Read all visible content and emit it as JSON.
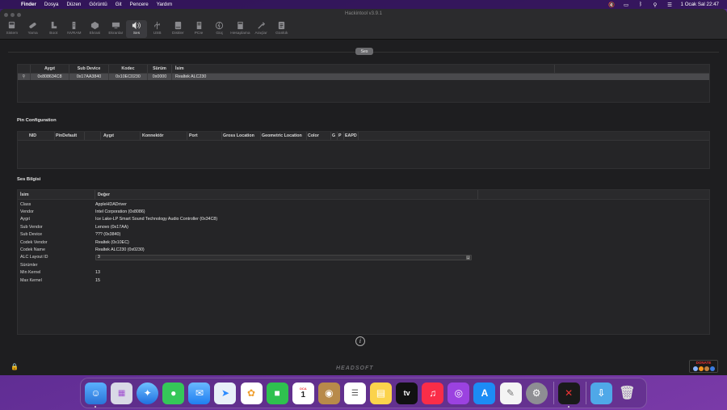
{
  "menubar": {
    "items": [
      "Finder",
      "Dosya",
      "Düzen",
      "Görüntü",
      "Git",
      "Pencere",
      "Yardım"
    ],
    "clock": "1 Ocak Sal  22:47"
  },
  "window": {
    "title": "Hackintool v3.9.1",
    "toolbar": [
      "Sistem",
      "Yama",
      "Boot",
      "NVRAM",
      "Ekrani",
      "Ekranlar",
      "Ses",
      "USB",
      "Diskler",
      "PCIe",
      "Güç",
      "Hesaplama",
      "Araçlar",
      "Günlük"
    ],
    "active_tab": "Ses"
  },
  "audio_devices": {
    "headers": [
      "Aygıt",
      "Sub Device",
      "Kodec",
      "Sürüm",
      "İsim"
    ],
    "rows": [
      [
        "0x808634C8",
        "0x17AA3840",
        "0x10EC0230",
        "0x0000",
        "Realtek ALC230"
      ]
    ]
  },
  "pin_configuration": {
    "title": "Pin Configuration",
    "headers": [
      "NID",
      "PinDefault",
      "Aygıt",
      "Konnektör",
      "Port",
      "Gross Location",
      "Geometric Location",
      "Color",
      "G",
      "P",
      "EAPD"
    ]
  },
  "audio_info": {
    "title": "Ses Bilgisi",
    "headers": [
      "İsim",
      "Değer"
    ],
    "rows": [
      {
        "key": "Class",
        "value": "AppleHDADriver"
      },
      {
        "key": "Vendor",
        "value": "Intel Corporation (0x8086)"
      },
      {
        "key": "Aygıt",
        "value": "Ice Lake-LP Smart Sound Technology Audio Controller (0x34C8)"
      },
      {
        "key": "Sub Vendor",
        "value": "Lenovo (0x17AA)"
      },
      {
        "key": "Sub Device",
        "value": "??? (0x3840)"
      },
      {
        "key": "Codek Vendor",
        "value": "Realtek (0x10EC)"
      },
      {
        "key": "Codek Name",
        "value": "Realtek ALC230 (0x0230)"
      },
      {
        "key": "ALC Layout ID",
        "value": "3"
      },
      {
        "key": "Sürümler",
        "value": ""
      },
      {
        "key": "Min Kernel",
        "value": "13"
      },
      {
        "key": "Max Kernel",
        "value": "15"
      }
    ]
  },
  "footer": {
    "brand": "HEADSOFT",
    "donate_label": "DONATE"
  },
  "dock": {
    "calendar_month": "OCA",
    "calendar_day": "1",
    "tv_label": "tv"
  }
}
